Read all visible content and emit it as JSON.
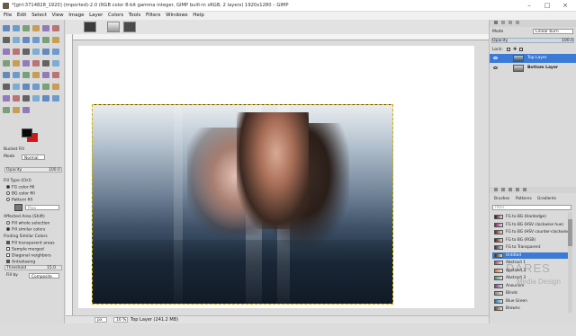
{
  "window": {
    "title": "*[girl-3714828_1920] (imported)-2.0 (RGB color 8-bit gamma integer, GIMP built-in sRGB, 2 layers) 1920x1280 – GIMP",
    "minimize": "–",
    "maximize": "□",
    "close": "×"
  },
  "menu": [
    "File",
    "Edit",
    "Select",
    "View",
    "Image",
    "Layer",
    "Colors",
    "Tools",
    "Filters",
    "Windows",
    "Help"
  ],
  "tool_options": {
    "title": "Bucket Fill",
    "mode_label": "Mode",
    "mode_value": "Normal",
    "opacity_label": "Opacity",
    "opacity_value": "100.0",
    "fill_type_label": "Fill Type  (Ctrl)",
    "fill_types": [
      "FG color fill",
      "BG color fill",
      "Pattern fill"
    ],
    "pattern_name": "Pine",
    "affected_label": "Affected Area  (Shift)",
    "affected": [
      "Fill whole selection",
      "Fill similar colors"
    ],
    "finding_label": "Finding Similar Colors",
    "checks": [
      "Fill transparent areas",
      "Sample merged",
      "Diagonal neighbors",
      "Antialiasing"
    ],
    "threshold_label": "Threshold",
    "threshold_value": "15.0",
    "fillby_label": "Fill by",
    "fillby_value": "Composite"
  },
  "status": {
    "unit": "px",
    "zoom": "16 %",
    "layer": "Top Layer (241.2 MB)"
  },
  "layers_panel": {
    "mode_label": "Mode",
    "mode_value": "Linear burn",
    "opacity_label": "Opacity",
    "opacity_value": "100.0",
    "lock_label": "Lock:",
    "layers": [
      {
        "name": "Top Layer",
        "active": true
      },
      {
        "name": "Bottom Layer",
        "active": false
      }
    ]
  },
  "gradients_panel": {
    "tabs": [
      "Brushes",
      "Patterns",
      "Gradients"
    ],
    "filter_placeholder": "filter",
    "items": [
      {
        "name": "FG to BG (Hardedge)",
        "color": "#4a0e0e"
      },
      {
        "name": "FG to BG (HSV clockwise hue)",
        "color": "#8a1a6a"
      },
      {
        "name": "FG to BG (HSV counter-clockwise)",
        "color": "#6a2a1a"
      },
      {
        "name": "FG to BG (RGB)",
        "color": "#6b1010"
      },
      {
        "name": "FG to Transparent",
        "color": "#333333"
      },
      {
        "name": "Untitled",
        "color": "#2c2c2c"
      },
      {
        "name": "Abstract 1",
        "color": "#b04a7a"
      },
      {
        "name": "Abstract 2",
        "color": "#d07a3a"
      },
      {
        "name": "Abstract 3",
        "color": "#3aa07a"
      },
      {
        "name": "Aneurism",
        "color": "#7a3aa0"
      },
      {
        "name": "Blinds",
        "color": "#888888"
      },
      {
        "name": "Blue Green",
        "color": "#1a7ab0"
      },
      {
        "name": "Browns",
        "color": "#7a4a1a"
      }
    ],
    "active_index": 5
  },
  "watermark": {
    "line1": "DARES",
    "line2": "Media Design"
  }
}
